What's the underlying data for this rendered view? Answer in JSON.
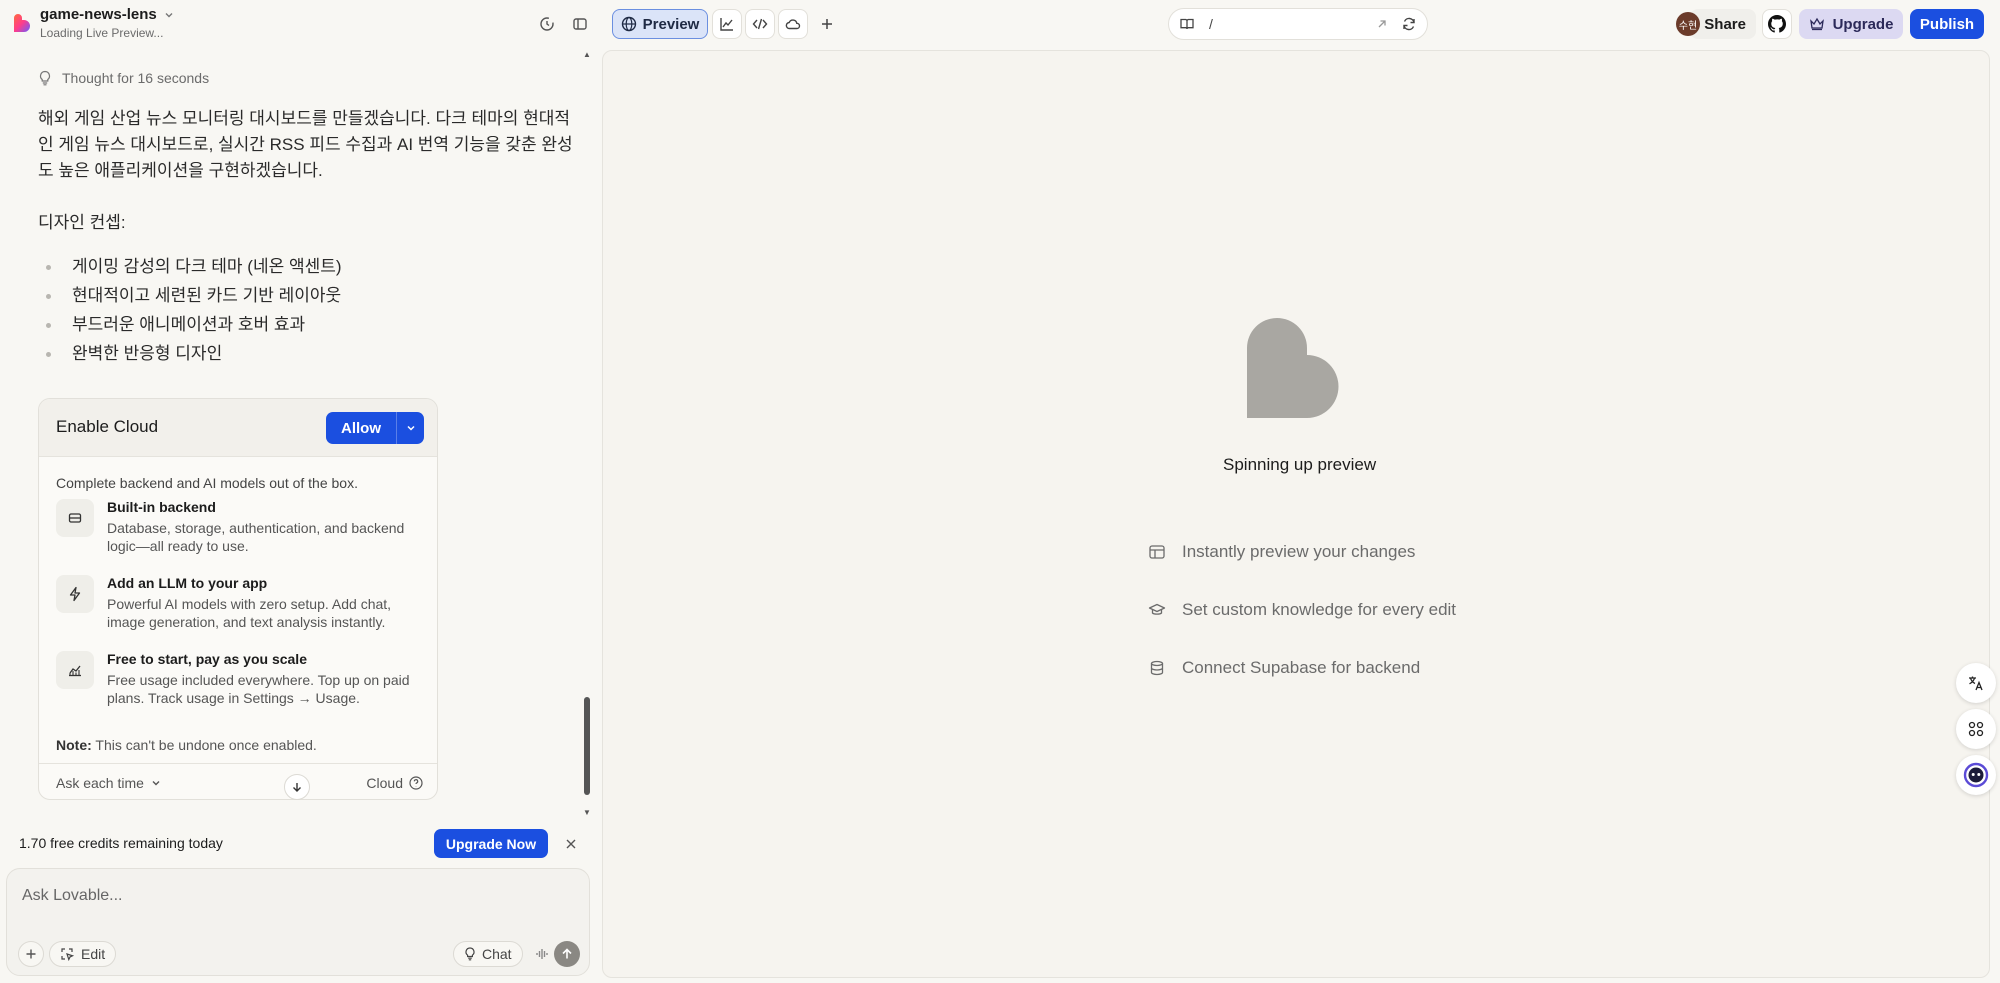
{
  "header": {
    "project_name": "game-news-lens",
    "project_status": "Loading Live Preview...",
    "preview_label": "Preview",
    "url_path": "/",
    "avatar_initials": "수현",
    "share_label": "Share",
    "upgrade_label": "Upgrade",
    "publish_label": "Publish"
  },
  "chat": {
    "thought": "Thought for 16 seconds",
    "intro": "해외 게임 산업 뉴스 모니터링 대시보드를 만들겠습니다. 다크 테마의 현대적인 게임 뉴스 대시보드로, 실시간 RSS 피드 수집과 AI 번역 기능을 갖춘 완성도 높은 애플리케이션을 구현하겠습니다.",
    "concept_heading": "디자인 컨셉:",
    "bullets": [
      "게이밍 감성의 다크 테마 (네온 액센트)",
      "현대적이고 세련된 카드 기반 레이아웃",
      "부드러운 애니메이션과 호버 효과",
      "완벽한 반응형 디자인"
    ]
  },
  "cloud_card": {
    "title": "Enable Cloud",
    "allow_label": "Allow",
    "description": "Complete backend and AI models out of the box.",
    "features": [
      {
        "title": "Built-in backend",
        "text": "Database, storage, authentication, and backend logic—all ready to use.",
        "icon": "database-card-icon"
      },
      {
        "title": "Add an LLM to your app",
        "text": "Powerful AI models with zero setup. Add chat, image generation, and text analysis instantly.",
        "icon": "lightning-icon"
      },
      {
        "title": "Free to start, pay as you scale",
        "text": "Free usage included everywhere. Top up on paid plans. Track usage in Settings → Usage.",
        "icon": "chart-icon"
      }
    ],
    "note_label": "Note:",
    "note_text": " This can't be undone once enabled.",
    "ask_each_time": "Ask each time",
    "cloud_link": "Cloud"
  },
  "credits": {
    "text": "1.70 free credits remaining today",
    "upgrade_now": "Upgrade Now"
  },
  "composer": {
    "placeholder": "Ask Lovable...",
    "edit_label": "Edit",
    "chat_label": "Chat"
  },
  "preview": {
    "status": "Spinning up preview",
    "tips": [
      "Instantly preview your changes",
      "Set custom knowledge for every edit",
      "Connect Supabase for backend"
    ]
  },
  "colors": {
    "accent": "#1b4fe0",
    "background": "#f8f7f3",
    "heart": "#a9a7a2"
  }
}
